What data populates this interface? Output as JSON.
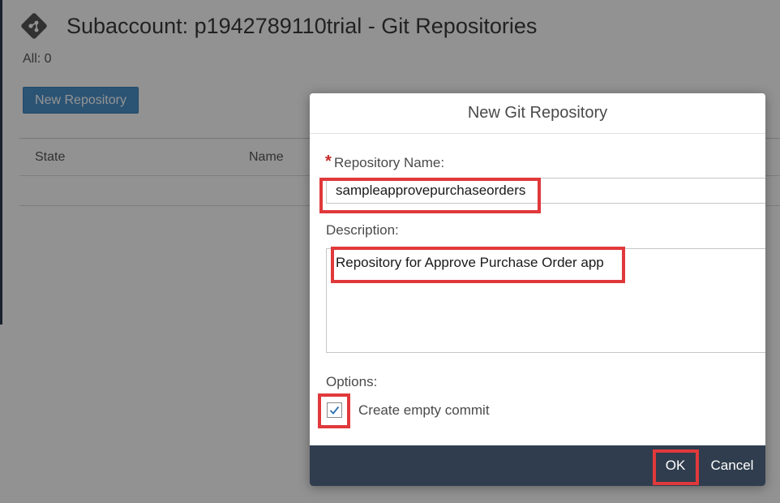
{
  "page": {
    "title": "Subaccount: p1942789110trial - Git Repositories",
    "count": "All: 0",
    "new_repository_button": "New Repository",
    "table": {
      "columns": [
        "State",
        "Name"
      ]
    }
  },
  "dialog": {
    "title": "New Git Repository",
    "required_marker": "*",
    "repository_name_label": "Repository Name:",
    "repository_name_value": "sampleapprovepurchaseorders",
    "description_label": "Description:",
    "description_value": "Repository for Approve Purchase Order app",
    "options_label": "Options:",
    "create_empty_commit_label": "Create empty commit",
    "create_empty_commit_checked": true,
    "ok_button": "OK",
    "cancel_button": "Cancel"
  },
  "icons": {
    "page_icon": "git-icon",
    "checkbox_mark": "check-icon"
  },
  "colors": {
    "accent": "#4a90c8",
    "footer": "#2f3d4e",
    "highlight": "#e0393b",
    "required": "#c62828"
  }
}
